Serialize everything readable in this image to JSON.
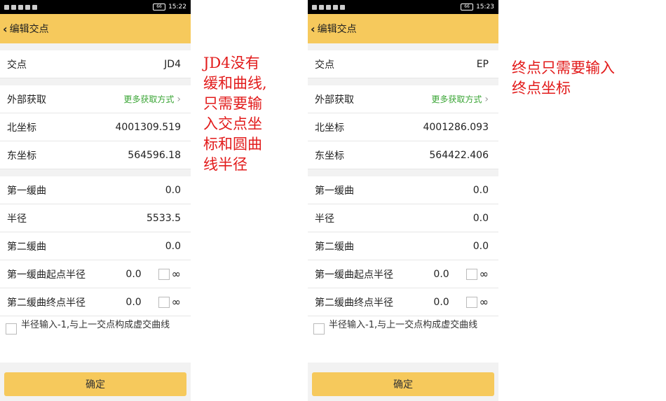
{
  "screens": [
    {
      "status_time": "15:22",
      "battery": "66",
      "title": "编辑交点",
      "point_label": "交点",
      "point_value": "JD4",
      "external_label": "外部获取",
      "external_link": "更多获取方式",
      "north_label": "北坐标",
      "north_value": "4001309.519",
      "east_label": "东坐标",
      "east_value": "564596.18",
      "spiral1_label": "第一缓曲",
      "spiral1_value": "0.0",
      "radius_label": "半径",
      "radius_value": "5533.5",
      "spiral2_label": "第二缓曲",
      "spiral2_value": "0.0",
      "spiral1_start_label": "第一缓曲起点半径",
      "spiral1_start_value": "0.0",
      "spiral2_end_label": "第二缓曲终点半径",
      "spiral2_end_value": "0.0",
      "infinity": "∞",
      "note": "半径输入-1,与上一交点构成虚交曲线",
      "ok": "确定"
    },
    {
      "status_time": "15:23",
      "battery": "66",
      "title": "编辑交点",
      "point_label": "交点",
      "point_value": "EP",
      "external_label": "外部获取",
      "external_link": "更多获取方式",
      "north_label": "北坐标",
      "north_value": "4001286.093",
      "east_label": "东坐标",
      "east_value": "564422.406",
      "spiral1_label": "第一缓曲",
      "spiral1_value": "0.0",
      "radius_label": "半径",
      "radius_value": "0.0",
      "spiral2_label": "第二缓曲",
      "spiral2_value": "0.0",
      "spiral1_start_label": "第一缓曲起点半径",
      "spiral1_start_value": "0.0",
      "spiral2_end_label": "第二缓曲终点半径",
      "spiral2_end_value": "0.0",
      "infinity": "∞",
      "note": "半径输入-1,与上一交点构成虚交曲线",
      "ok": "确定"
    }
  ],
  "annotations": {
    "left_lines": [
      "JD4没有",
      "缓和曲线,",
      "只需要输",
      "入交点坐",
      "标和圆曲",
      "线半径"
    ],
    "right_lines": [
      "终点只需要输入",
      "终点坐标"
    ]
  },
  "colors": {
    "accent": "#f6c95c",
    "link_green": "#3aa535",
    "annotation_red": "#e21b1b"
  }
}
